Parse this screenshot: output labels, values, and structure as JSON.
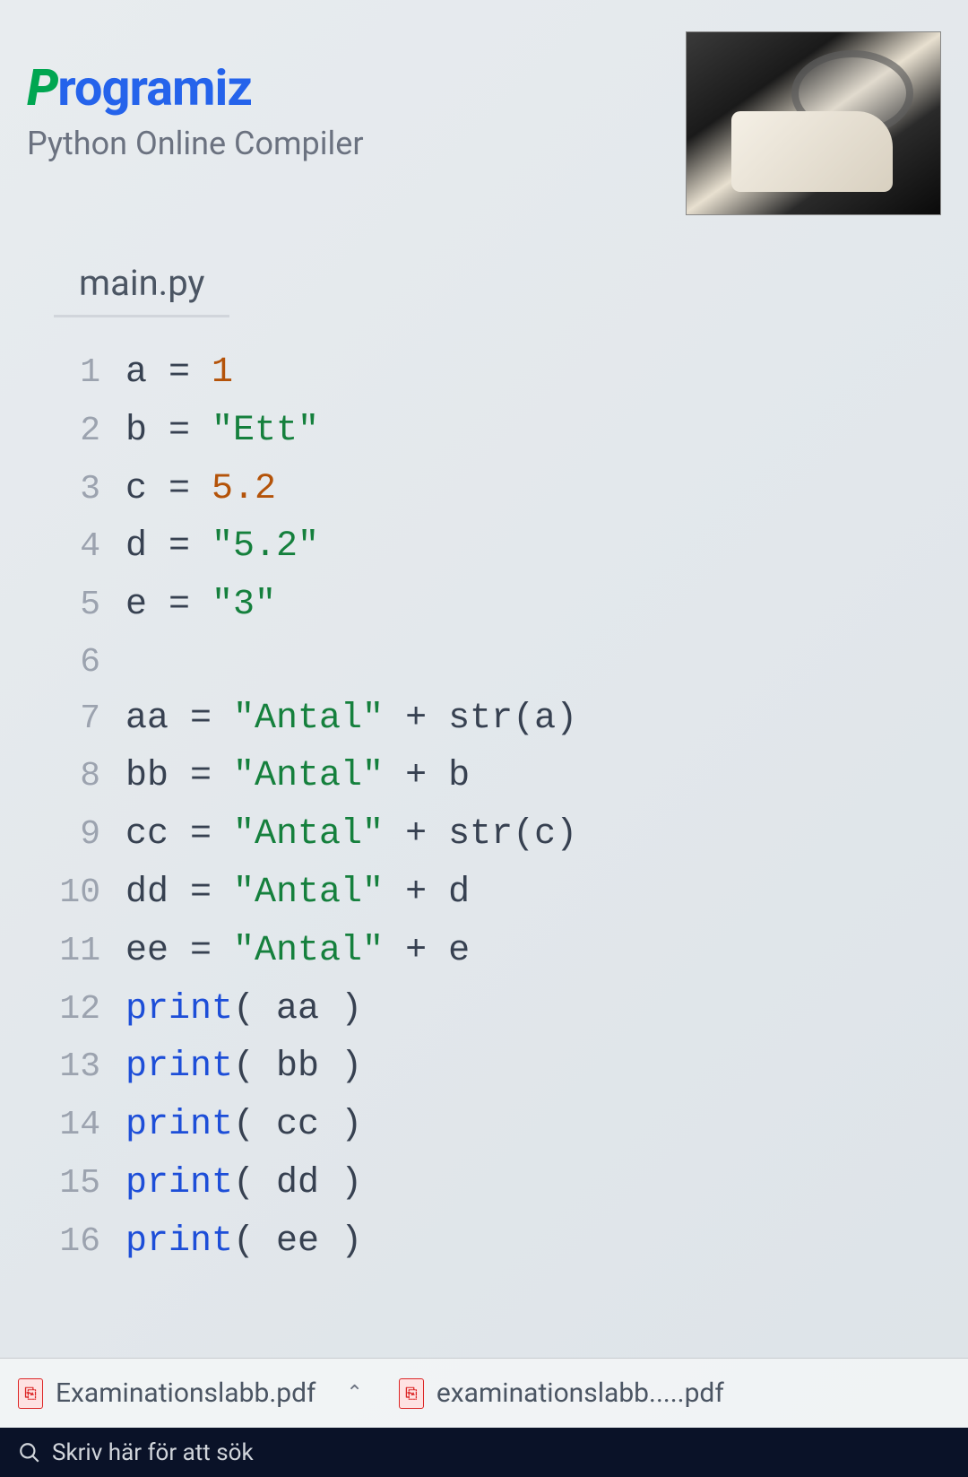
{
  "header": {
    "logo_first": "P",
    "logo_rest": "rogramiz",
    "subtitle": "Python Online Compiler"
  },
  "editor": {
    "tab_label": "main.py",
    "lines": [
      {
        "n": "1",
        "tokens": [
          [
            "id",
            "a"
          ],
          [
            "op",
            " = "
          ],
          [
            "num",
            "1"
          ]
        ]
      },
      {
        "n": "2",
        "tokens": [
          [
            "id",
            "b"
          ],
          [
            "op",
            " = "
          ],
          [
            "str",
            "\"Ett\""
          ]
        ]
      },
      {
        "n": "3",
        "tokens": [
          [
            "id",
            "c"
          ],
          [
            "op",
            " = "
          ],
          [
            "num",
            "5.2"
          ]
        ]
      },
      {
        "n": "4",
        "tokens": [
          [
            "id",
            "d"
          ],
          [
            "op",
            " = "
          ],
          [
            "str",
            "\"5.2\""
          ]
        ]
      },
      {
        "n": "5",
        "tokens": [
          [
            "id",
            "e"
          ],
          [
            "op",
            " = "
          ],
          [
            "str",
            "\"3\""
          ]
        ]
      },
      {
        "n": "6",
        "tokens": []
      },
      {
        "n": "7",
        "tokens": [
          [
            "id",
            "aa"
          ],
          [
            "op",
            " = "
          ],
          [
            "str",
            "\"Antal\""
          ],
          [
            "op",
            " + "
          ],
          [
            "id",
            "str"
          ],
          [
            "op",
            "("
          ],
          [
            "id",
            "a"
          ],
          [
            "op",
            ")"
          ]
        ]
      },
      {
        "n": "8",
        "tokens": [
          [
            "id",
            "bb"
          ],
          [
            "op",
            " = "
          ],
          [
            "str",
            "\"Antal\""
          ],
          [
            "op",
            " + "
          ],
          [
            "id",
            "b"
          ]
        ]
      },
      {
        "n": "9",
        "tokens": [
          [
            "id",
            "cc"
          ],
          [
            "op",
            " = "
          ],
          [
            "str",
            "\"Antal\""
          ],
          [
            "op",
            " + "
          ],
          [
            "id",
            "str"
          ],
          [
            "op",
            "("
          ],
          [
            "id",
            "c"
          ],
          [
            "op",
            ")"
          ]
        ]
      },
      {
        "n": "10",
        "tokens": [
          [
            "id",
            "dd"
          ],
          [
            "op",
            " = "
          ],
          [
            "str",
            "\"Antal\""
          ],
          [
            "op",
            " + "
          ],
          [
            "id",
            "d"
          ]
        ]
      },
      {
        "n": "11",
        "tokens": [
          [
            "id",
            "ee"
          ],
          [
            "op",
            " = "
          ],
          [
            "str",
            "\"Antal\""
          ],
          [
            "op",
            " + "
          ],
          [
            "id",
            "e"
          ]
        ]
      },
      {
        "n": "12",
        "tokens": [
          [
            "fn",
            "print"
          ],
          [
            "op",
            "( "
          ],
          [
            "id",
            "aa"
          ],
          [
            "op",
            " )"
          ]
        ]
      },
      {
        "n": "13",
        "tokens": [
          [
            "fn",
            "print"
          ],
          [
            "op",
            "( "
          ],
          [
            "id",
            "bb"
          ],
          [
            "op",
            " )"
          ]
        ]
      },
      {
        "n": "14",
        "tokens": [
          [
            "fn",
            "print"
          ],
          [
            "op",
            "( "
          ],
          [
            "id",
            "cc"
          ],
          [
            "op",
            " )"
          ]
        ]
      },
      {
        "n": "15",
        "tokens": [
          [
            "fn",
            "print"
          ],
          [
            "op",
            "( "
          ],
          [
            "id",
            "dd"
          ],
          [
            "op",
            " )"
          ]
        ]
      },
      {
        "n": "16",
        "tokens": [
          [
            "fn",
            "print"
          ],
          [
            "op",
            "( "
          ],
          [
            "id",
            "ee"
          ],
          [
            "op",
            " )"
          ]
        ]
      }
    ]
  },
  "downloads": {
    "items": [
      {
        "label": "Examinationslabb.pdf"
      },
      {
        "label": "examinationslabb.....pdf"
      }
    ]
  },
  "taskbar": {
    "search_placeholder": "Skriv här för att sök"
  }
}
